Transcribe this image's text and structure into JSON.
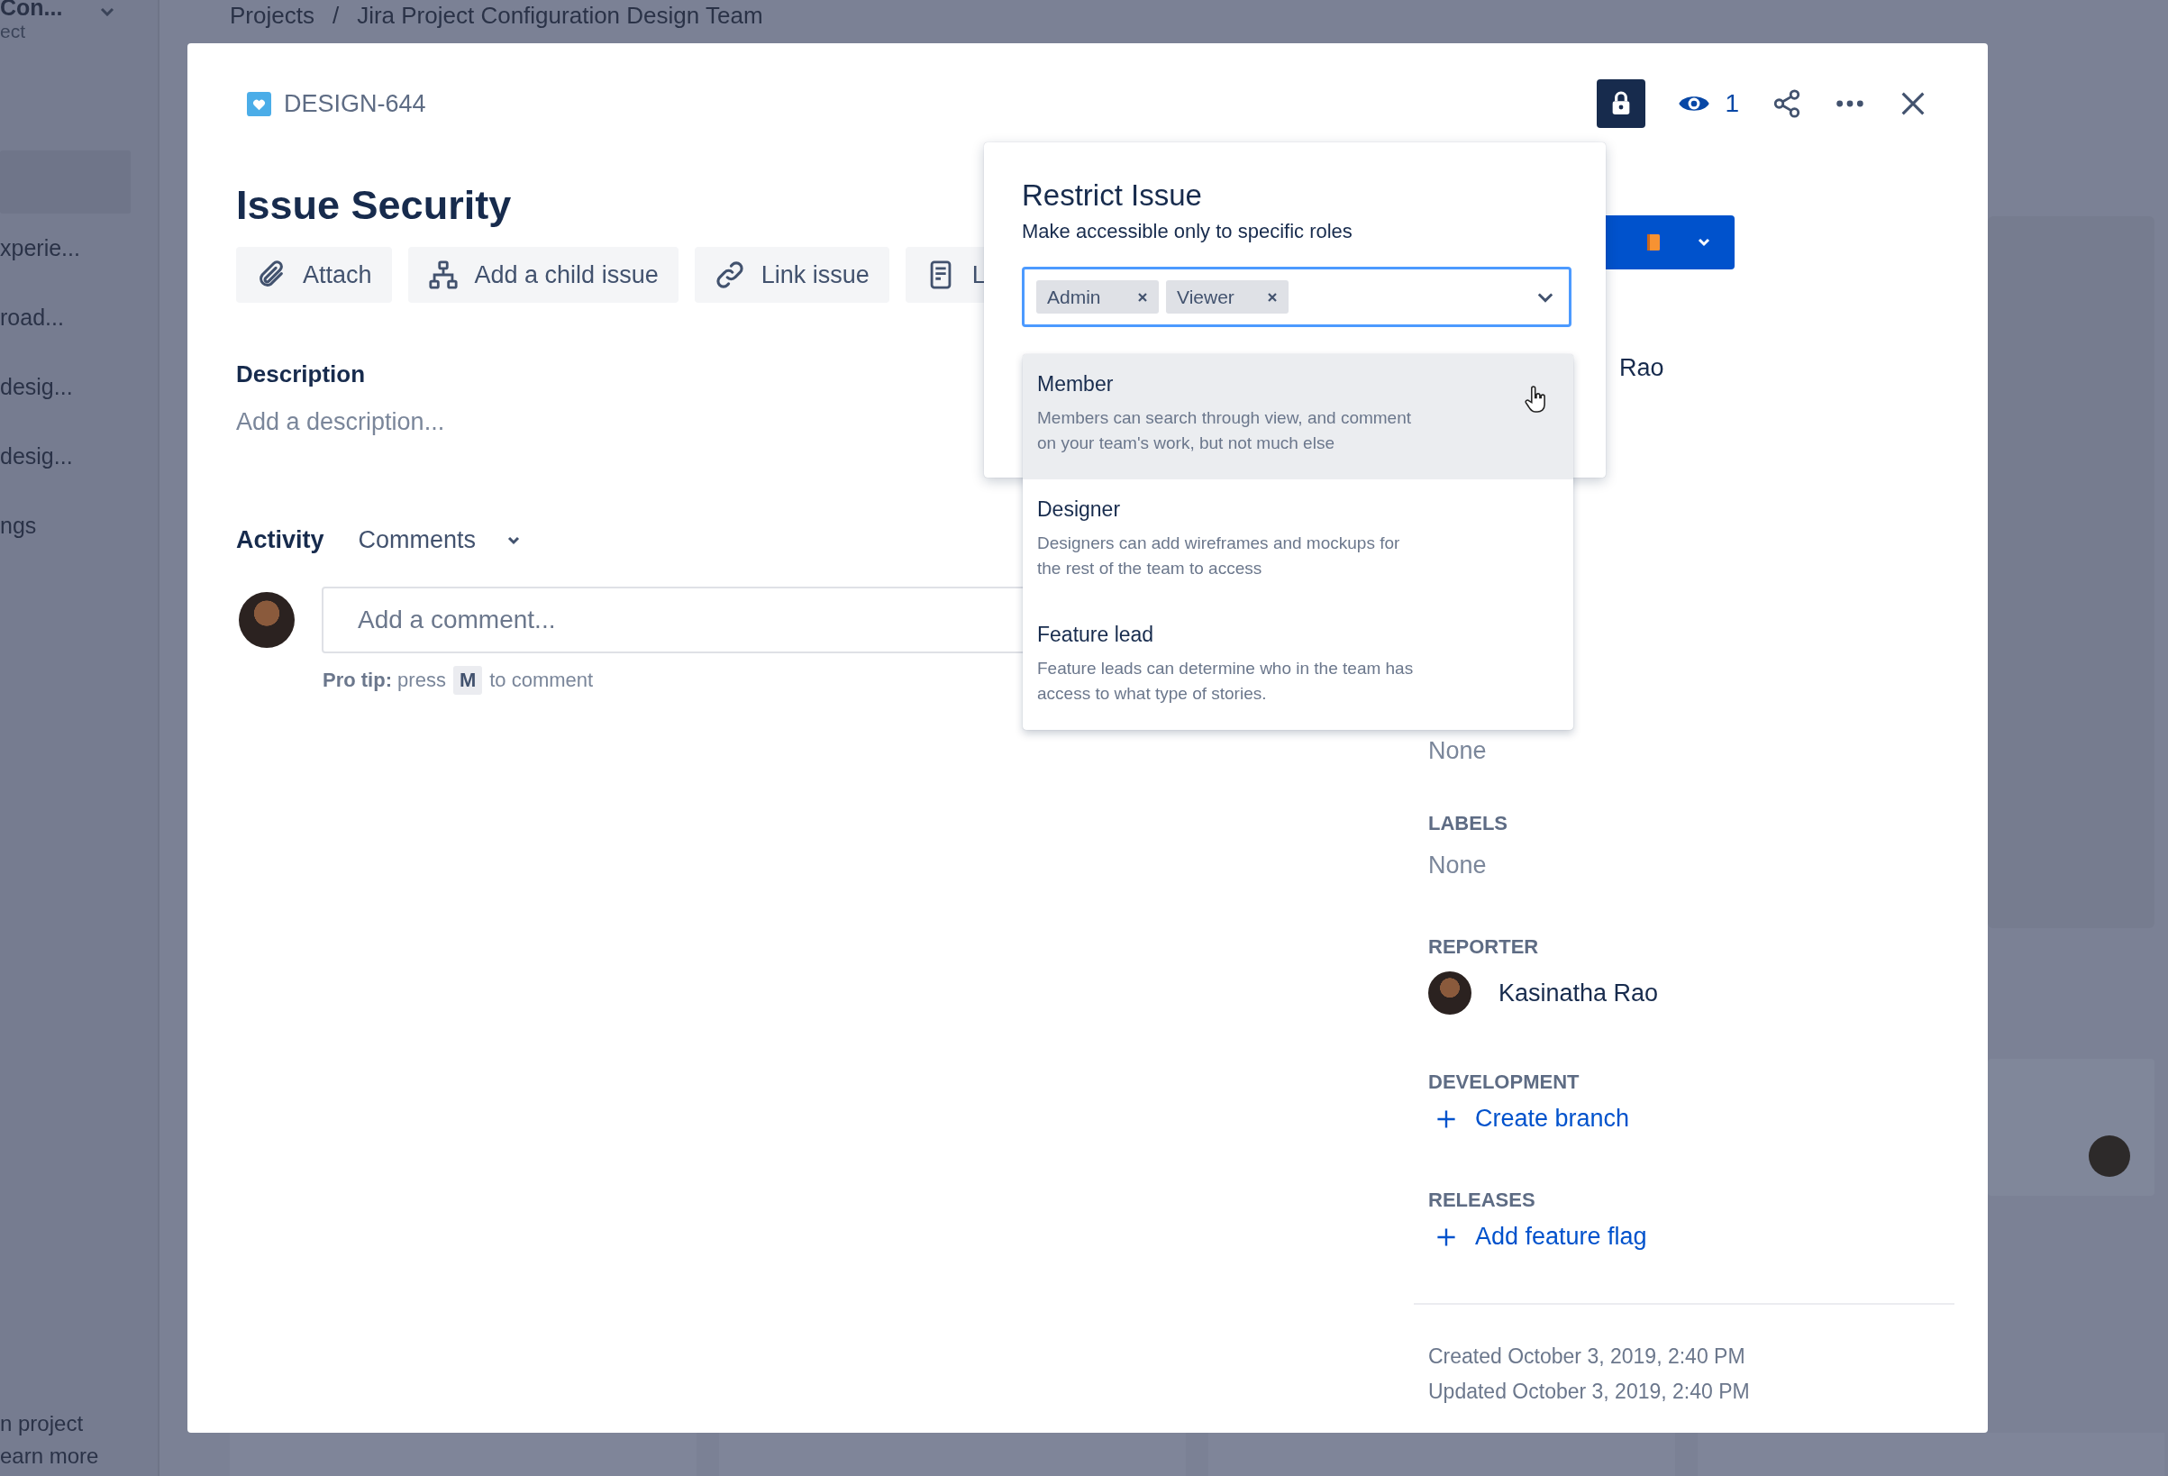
{
  "sidebar": {
    "project_name": "Con...",
    "project_type": "ect",
    "items": [
      {
        "label": "xperie..."
      },
      {
        "label": "road..."
      },
      {
        "label": "desig..."
      },
      {
        "label": "desig..."
      },
      {
        "label": "ngs"
      }
    ],
    "footer": [
      "n project",
      "earn more"
    ]
  },
  "breadcrumb": {
    "items": [
      "Projects",
      "Jira Project Configuration Design Team"
    ],
    "separator": "/"
  },
  "issue": {
    "key": "DESIGN-644",
    "restricted": true,
    "watchers": "1",
    "title": "Issue Security",
    "actions": [
      {
        "kind": "paperclip",
        "label": "Attach"
      },
      {
        "kind": "hierarchy",
        "label": "Add a child issue"
      },
      {
        "kind": "link",
        "label": "Link issue"
      },
      {
        "kind": "document",
        "label": "L"
      }
    ],
    "description": {
      "heading": "Description",
      "placeholder": "Add a description..."
    },
    "activity": {
      "heading": "Activity",
      "filter": "Comments",
      "comment_placeholder": "Add a comment...",
      "pro_tip": "**Pro tip:** press",
      "shortcut": "M",
      "pro_tip_end": "to comment"
    }
  },
  "details": {
    "assignee_fragment": "Rao",
    "field_fragment": "None",
    "fields": [
      {
        "kind": "text",
        "label": "LABELS",
        "value": "None"
      },
      {
        "kind": "person",
        "label": "REPORTER",
        "value": "Kasinatha Rao"
      },
      {
        "kind": "action",
        "label": "DEVELOPMENT",
        "value": "Create branch"
      },
      {
        "kind": "action",
        "label": "RELEASES",
        "value": "Add feature flag"
      }
    ],
    "created": "Created October 3, 2019, 2:40 PM",
    "updated": "Updated October 3, 2019, 2:40 PM"
  },
  "popover": {
    "title": "Restrict Issue",
    "subtitle": "Make accessible only to specific roles",
    "tags": [
      "Admin",
      "Viewer"
    ],
    "options": [
      {
        "label": "Member",
        "description": "Members can search through view, and comment\non your team's work, but not much else",
        "highlighted": true
      },
      {
        "label": "Designer",
        "description": "Designers can add wireframes and mockups for\nthe rest of the team to access",
        "highlighted": false
      },
      {
        "label": "Feature lead",
        "description": "Feature leads can determine who in the team has\naccess to what type of stories.",
        "highlighted": false
      }
    ]
  }
}
